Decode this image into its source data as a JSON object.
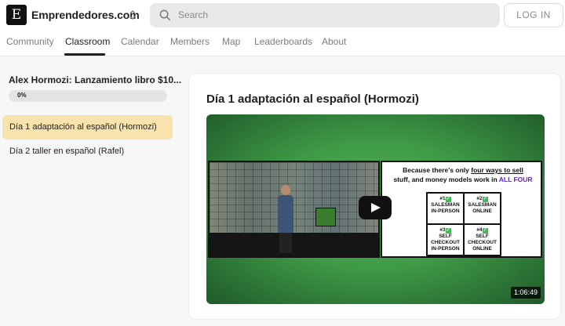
{
  "header": {
    "logo_letter": "E",
    "site_name": "Emprendedores.com",
    "search_placeholder": "Search",
    "login_label": "LOG IN"
  },
  "tabs": [
    {
      "label": "Community",
      "active": false
    },
    {
      "label": "Classroom",
      "active": true
    },
    {
      "label": "Calendar",
      "active": false
    },
    {
      "label": "Members",
      "active": false
    },
    {
      "label": "Map",
      "active": false
    },
    {
      "label": "Leaderboards",
      "active": false
    },
    {
      "label": "About",
      "active": false
    }
  ],
  "sidebar": {
    "course_title": "Alex Hormozi: Lanzamiento libro $10...",
    "progress_text": "0%",
    "progress_value": 0,
    "lessons": [
      {
        "label": "Día 1 adaptación al español (Hormozi)",
        "active": true
      },
      {
        "label": "Día 2 taller en español (Rafel)",
        "active": false
      }
    ]
  },
  "main": {
    "title": "Día 1 adaptación al español (Hormozi)",
    "video": {
      "duration": "1:06:49",
      "slide": {
        "line1": "Because there's only",
        "line1_underlined": "four ways to sell",
        "line2": "stuff, and money models work in",
        "line2_highlight": "ALL FOUR",
        "cells": [
          {
            "num": "#1",
            "text": "SALESMAN IN-PERSON"
          },
          {
            "num": "#2",
            "text": "SALESMAN ONLINE"
          },
          {
            "num": "#3",
            "text": "SELF CHECKOUT IN-PERSON"
          },
          {
            "num": "#4",
            "text": "SELF CHECKOUT ONLINE"
          }
        ]
      }
    }
  },
  "colors": {
    "active_lesson_bg": "#f8e3ad",
    "slide_highlight": "#6a1fd1",
    "check_green": "#3fb950"
  }
}
